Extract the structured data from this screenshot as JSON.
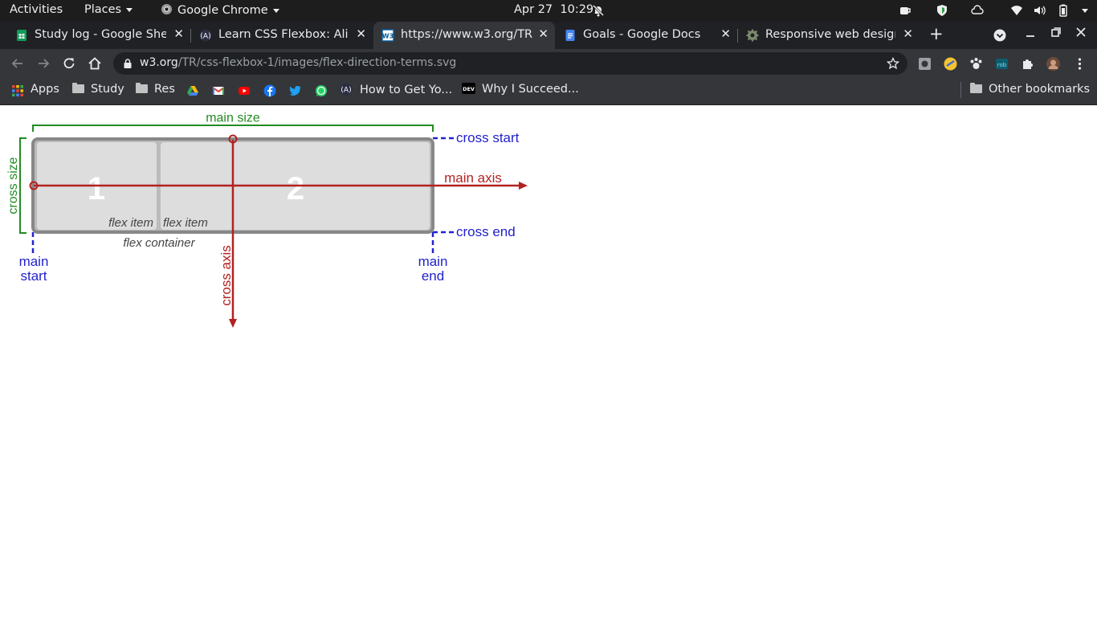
{
  "system_bar": {
    "activities": "Activities",
    "places": "Places",
    "app": "Google Chrome",
    "date": "Apr 27",
    "time": "10:29"
  },
  "tabs": [
    {
      "title": "Study log - Google Sheet",
      "icon": "sheets-icon",
      "active": false
    },
    {
      "title": "Learn CSS Flexbox: Align",
      "icon": "scrimba-icon",
      "active": false
    },
    {
      "title": "https://www.w3.org/TR",
      "icon": "w3c-icon",
      "active": true
    },
    {
      "title": "Goals - Google Docs",
      "icon": "docs-icon",
      "active": false
    },
    {
      "title": "Responsive web design",
      "icon": "gear-favicon-icon",
      "active": false
    }
  ],
  "address_bar": {
    "host": "w3.org",
    "path": "/TR/css-flexbox-1/images/flex-direction-terms.svg"
  },
  "bookmarks": {
    "apps": "Apps",
    "items": [
      "Study",
      "Res"
    ],
    "link1": "How to Get Yo...",
    "link2": "Why I Succeed...",
    "other": "Other bookmarks"
  },
  "diagram_labels": {
    "main_size": "main size",
    "cross_size": "cross size",
    "cross_start": "cross start",
    "cross_end": "cross end",
    "main_axis": "main axis",
    "cross_axis": "cross axis",
    "item1_number": "1",
    "item2_number": "2",
    "flex_item": "flex item",
    "flex_container": "flex container",
    "main": "main",
    "start": "start",
    "end": "end"
  },
  "colors": {
    "size_green": "#228b22",
    "axis_red": "#b22222",
    "edge_blue": "#2222cc",
    "container_gray": "#888888",
    "item_fill": "#dddddd"
  }
}
